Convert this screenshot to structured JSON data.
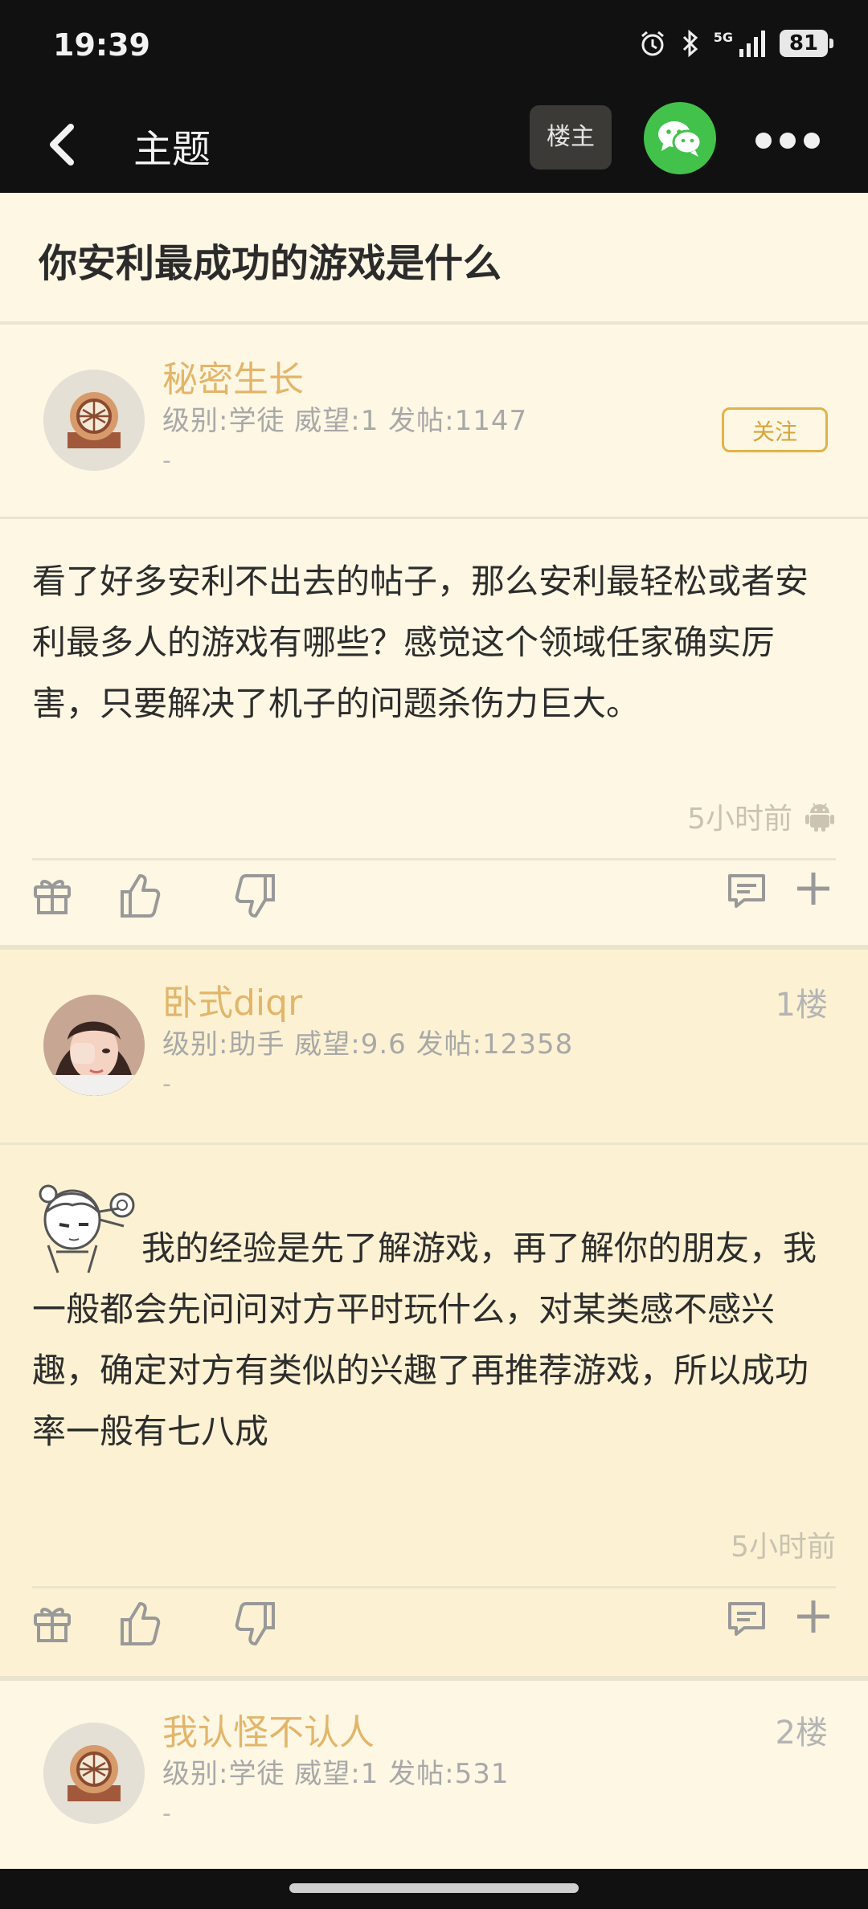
{
  "status_bar": {
    "time": "19:39",
    "network": "5G",
    "battery": "81"
  },
  "topbar": {
    "title": "主题",
    "op_button": "楼主",
    "wechat_icon": "wechat-icon",
    "more_icon": "more-dots-icon"
  },
  "thread": {
    "title": "你安利最成功的游戏是什么"
  },
  "posts": [
    {
      "username": "秘密生长",
      "info": "级别:学徒 威望:1 发帖:1147",
      "signature": "-",
      "follow_label": "关注",
      "body": "看了好多安利不出去的帖子，那么安利最轻松或者安利最多人的游戏有哪些？感觉这个领域任家确实厉害，只要解决了机子的问题杀伤力巨大。",
      "time": "5小时前",
      "device_icon": "android-icon"
    },
    {
      "username": "卧式diqr",
      "info": "级别:助手 威望:9.6 发帖:12358",
      "signature": "-",
      "floor": "1楼",
      "body": "我的经验是先了解游戏，再了解你的朋友，我一般都会先问问对方平时玩什么，对某类感不感兴趣，确定对方有类似的兴趣了再推荐游戏，所以成功率一般有七八成",
      "time": "5小时前"
    },
    {
      "username": "我认怪不认人",
      "info": "级别:学徒 威望:1 发帖:531",
      "signature": "-",
      "floor": "2楼"
    }
  ]
}
